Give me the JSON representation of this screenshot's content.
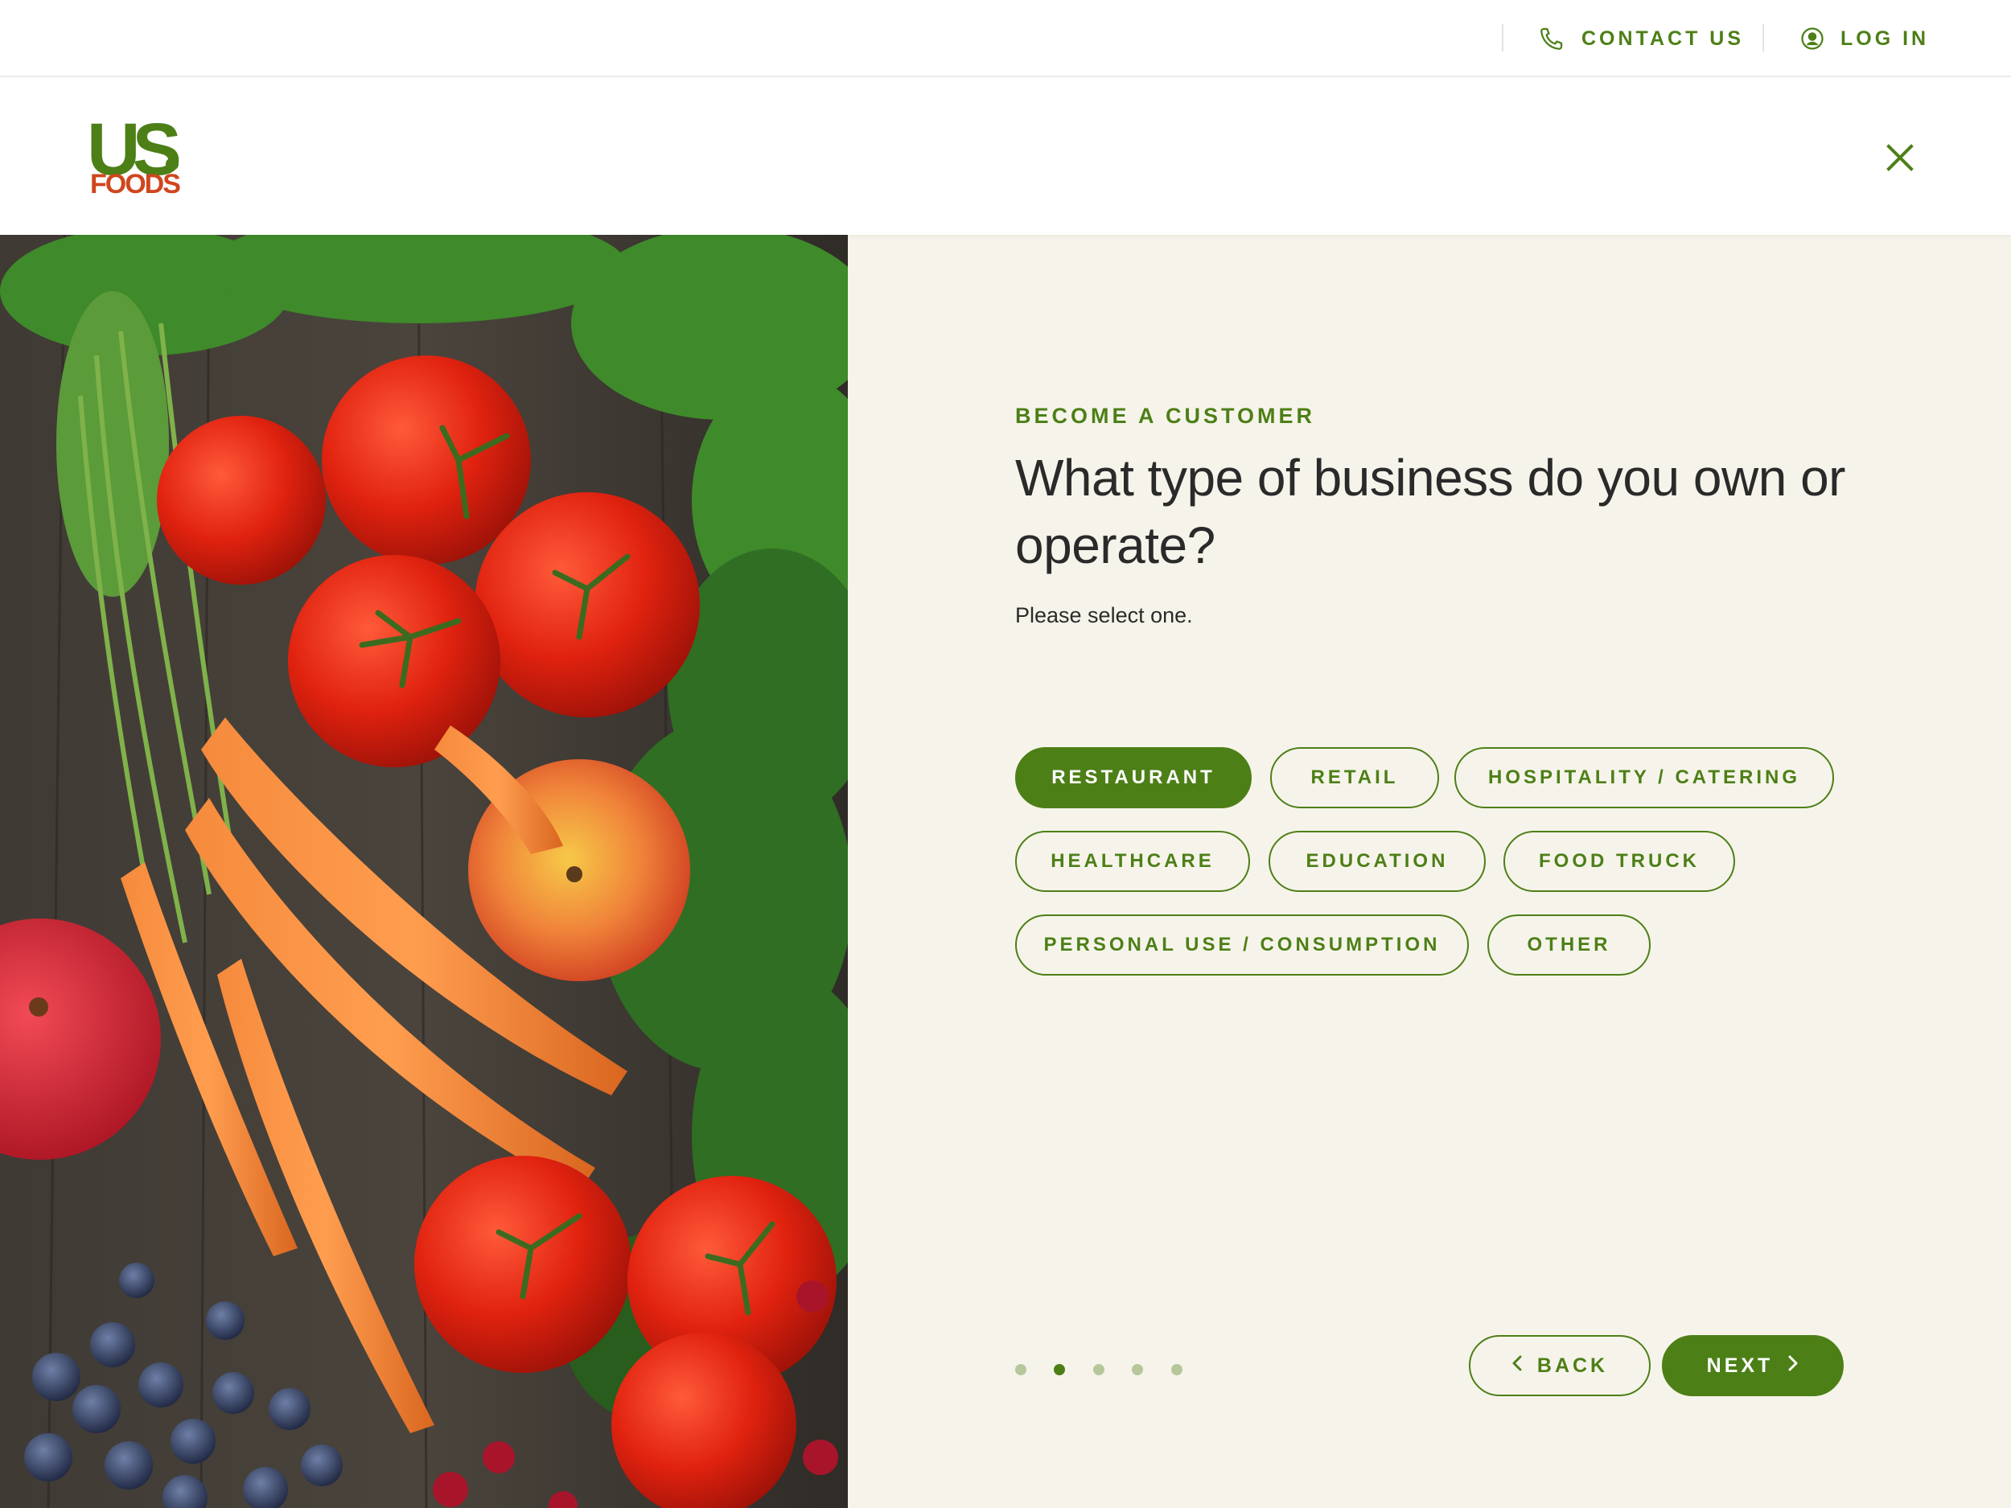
{
  "utility": {
    "contact_label": "CONTACT US",
    "login_label": "LOG IN"
  },
  "brand": {
    "logo_top": "US",
    "logo_bottom": "FOODS",
    "green": "#4d7f17",
    "orange": "#d0461e",
    "panel_bg": "#f6f4ea"
  },
  "form": {
    "eyebrow": "BECOME A CUSTOMER",
    "title": "What type of business do you own or operate?",
    "subtitle": "Please select one.",
    "options": [
      {
        "label": "RESTAURANT",
        "selected": true
      },
      {
        "label": "RETAIL",
        "selected": false
      },
      {
        "label": "HOSPITALITY / CATERING",
        "selected": false
      },
      {
        "label": "HEALTHCARE",
        "selected": false
      },
      {
        "label": "EDUCATION",
        "selected": false
      },
      {
        "label": "FOOD TRUCK",
        "selected": false
      },
      {
        "label": "PERSONAL USE / CONSUMPTION",
        "selected": false
      },
      {
        "label": "OTHER",
        "selected": false
      }
    ]
  },
  "progress": {
    "total_steps": 5,
    "current_step": 2
  },
  "navigation": {
    "back_label": "BACK",
    "next_label": "NEXT"
  },
  "icons": {
    "contact": "phone-icon",
    "login": "user-circle-icon",
    "close": "close-icon",
    "back": "chevron-left-icon",
    "next": "chevron-right-icon"
  }
}
